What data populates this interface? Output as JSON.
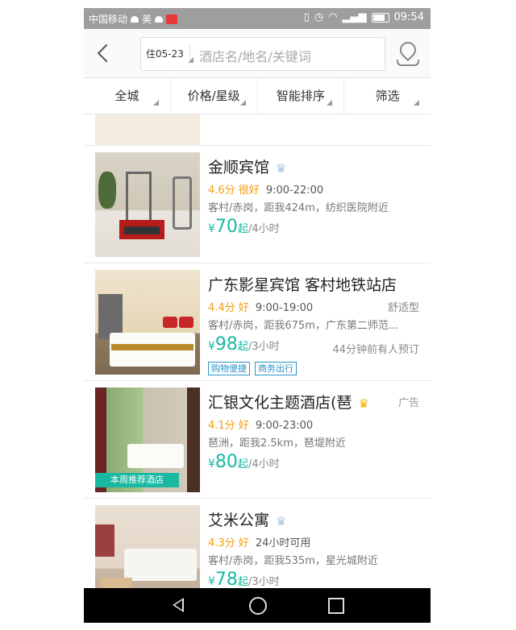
{
  "status_bar": {
    "carrier": "中国移动",
    "extra_label": "美",
    "time": "09:54"
  },
  "header": {
    "date_chip": "住05-23",
    "search_placeholder": "酒店名/地名/关键词"
  },
  "filters": [
    {
      "label": "全城"
    },
    {
      "label": "价格/星级"
    },
    {
      "label": "智能排序"
    },
    {
      "label": "筛选"
    }
  ],
  "hotels": [
    {
      "name": "金顺宾馆",
      "rating": "4.6分 很好",
      "hours": "9:00-22:00",
      "address": "客村/赤岗，距我424m，纺织医院附近",
      "price_symbol": "¥",
      "price": "70",
      "price_suffix": "起",
      "unit": "/4小时"
    },
    {
      "name": "广东影星宾馆 客村地铁站店",
      "rating": "4.4分 好",
      "hours": "9:00-19:00",
      "type": "舒适型",
      "address": "客村/赤岗，距我675m，广东第二师范...",
      "price_symbol": "¥",
      "price": "98",
      "price_suffix": "起",
      "unit": "/3小时",
      "booking_note": "44分钟前有人预订",
      "tags": [
        "购物便捷",
        "商务出行"
      ]
    },
    {
      "name": "汇银文化主题酒店(琶",
      "ad_label": "广告",
      "rating": "4.1分 好",
      "hours": "9:00-23:00",
      "address": "琶洲，距我2.5km，琶堤附近",
      "price_symbol": "¥",
      "price": "80",
      "price_suffix": "起",
      "unit": "/4小时",
      "badge": "本周推荐酒店"
    },
    {
      "name": "艾米公寓",
      "rating": "4.3分 好",
      "hours": "24小时可用",
      "address": "客村/赤岗，距我535m，星光城附近",
      "price_symbol": "¥",
      "price": "78",
      "price_suffix": "起",
      "unit": "/3小时"
    }
  ]
}
